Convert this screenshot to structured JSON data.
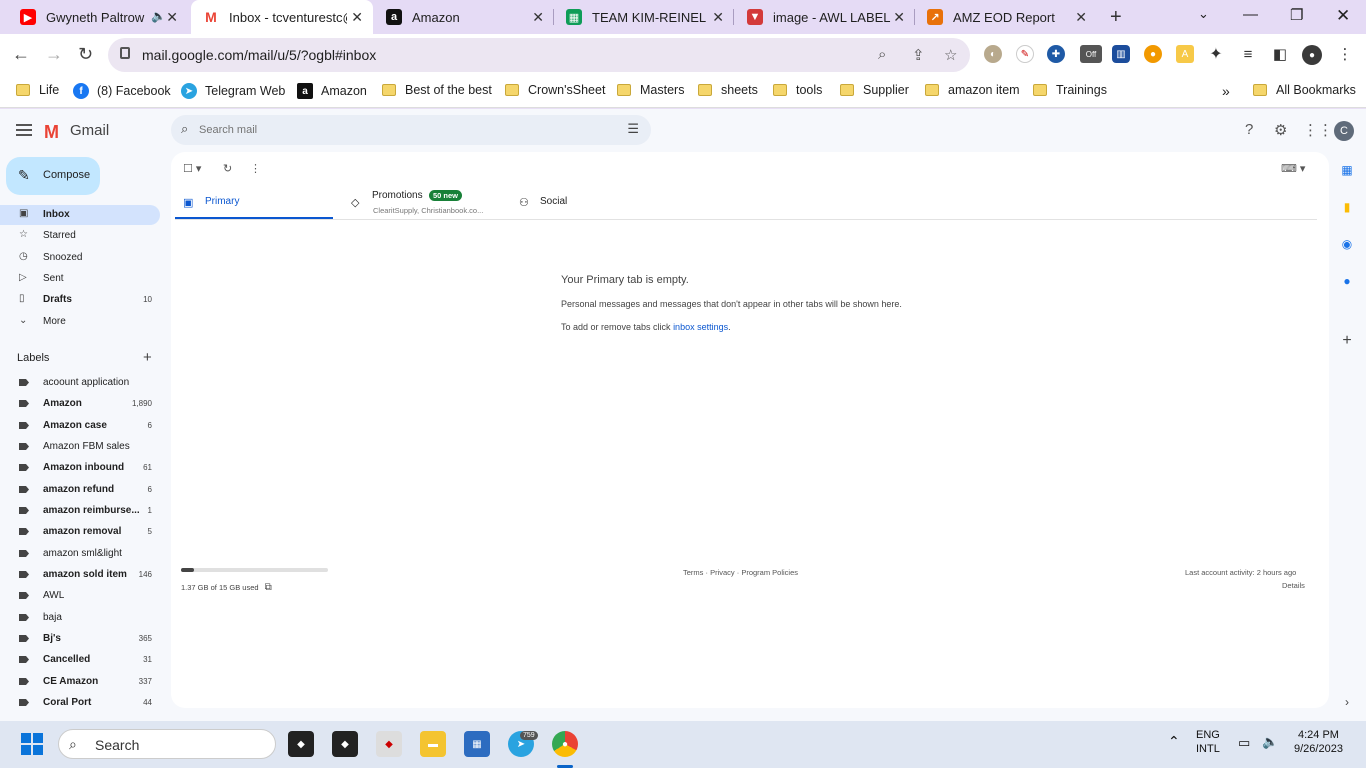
{
  "browser": {
    "tabs": [
      {
        "title": "Gwyneth Paltrow",
        "icon": "youtube-icon",
        "color": "#ff0000",
        "audio": true
      },
      {
        "title": "Inbox - tcventurestc@",
        "icon": "gmail-icon",
        "color": "#ea4335",
        "active": true
      },
      {
        "title": "Amazon",
        "icon": "amazon-icon",
        "color": "#111111"
      },
      {
        "title": "TEAM KIM-REINEL PR",
        "icon": "sheets-icon",
        "color": "#0f9d58"
      },
      {
        "title": "image - AWL LABEL",
        "icon": "vivaldi-icon",
        "color": "#d33a3a"
      },
      {
        "title": "AMZ EOD Report",
        "icon": "report-icon",
        "color": "#e8710a"
      }
    ],
    "url": "mail.google.com/mail/u/5/?ogbl#inbox",
    "ext_badge": "Off",
    "bookmarks": [
      {
        "label": "Life",
        "type": "folder"
      },
      {
        "label": "(8) Facebook",
        "type": "facebook"
      },
      {
        "label": "Telegram Web",
        "type": "telegram"
      },
      {
        "label": "Amazon",
        "type": "amazon"
      },
      {
        "label": "Best of the best",
        "type": "folder"
      },
      {
        "label": "Crown'sSheet",
        "type": "folder"
      },
      {
        "label": "Masters",
        "type": "folder"
      },
      {
        "label": "sheets",
        "type": "folder"
      },
      {
        "label": "tools",
        "type": "folder"
      },
      {
        "label": "Supplier",
        "type": "folder"
      },
      {
        "label": "amazon item",
        "type": "folder"
      },
      {
        "label": "Trainings",
        "type": "folder"
      }
    ],
    "all_bookmarks": "All Bookmarks"
  },
  "gmail": {
    "app_name": "Gmail",
    "search_placeholder": "Search mail",
    "avatar_letter": "C",
    "compose": "Compose",
    "nav": [
      {
        "label": "Inbox",
        "icon": "inbox-icon",
        "count": "",
        "active": true,
        "bold": true
      },
      {
        "label": "Starred",
        "icon": "star-icon",
        "count": ""
      },
      {
        "label": "Snoozed",
        "icon": "clock-icon",
        "count": ""
      },
      {
        "label": "Sent",
        "icon": "send-icon",
        "count": ""
      },
      {
        "label": "Drafts",
        "icon": "draft-icon",
        "count": "10",
        "bold": true
      },
      {
        "label": "More",
        "icon": "chevron-down-icon",
        "count": ""
      }
    ],
    "labels_header": "Labels",
    "labels": [
      {
        "label": "acoount application",
        "count": "",
        "bold": false
      },
      {
        "label": "Amazon",
        "count": "1,890",
        "bold": true
      },
      {
        "label": "Amazon case",
        "count": "6",
        "bold": true
      },
      {
        "label": "Amazon FBM sales",
        "count": "",
        "bold": false
      },
      {
        "label": "Amazon inbound",
        "count": "61",
        "bold": true
      },
      {
        "label": "amazon refund",
        "count": "6",
        "bold": true
      },
      {
        "label": "amazon reimburse...",
        "count": "1",
        "bold": true
      },
      {
        "label": "amazon removal",
        "count": "5",
        "bold": true
      },
      {
        "label": "amazon sml&light",
        "count": "",
        "bold": false
      },
      {
        "label": "amazon sold item",
        "count": "146",
        "bold": true
      },
      {
        "label": "AWL",
        "count": "",
        "bold": false
      },
      {
        "label": "baja",
        "count": "",
        "bold": false
      },
      {
        "label": "Bj's",
        "count": "365",
        "bold": true
      },
      {
        "label": "Cancelled",
        "count": "31",
        "bold": true
      },
      {
        "label": "CE Amazon",
        "count": "337",
        "bold": true
      },
      {
        "label": "Coral Port",
        "count": "44",
        "bold": true
      }
    ],
    "category_tabs": {
      "primary": "Primary",
      "promotions": "Promotions",
      "promotions_badge": "50 new",
      "promotions_senders": "ClearitSupply, Christianbook.co...",
      "social": "Social"
    },
    "empty": {
      "title": "Your Primary tab is empty.",
      "line1": "Personal messages and messages that don't appear in other tabs will be shown here.",
      "line2_prefix": "To add or remove tabs click ",
      "line2_link": "inbox settings",
      "line2_suffix": "."
    },
    "storage": {
      "text": "1.37 GB of 15 GB used",
      "fraction": 0.091
    },
    "footer": {
      "links": "Terms · Privacy · Program Policies",
      "activity": "Last account activity: 2 hours ago",
      "details": "Details"
    }
  },
  "taskbar": {
    "search": "Search",
    "telegram_badge": "759",
    "lang1": "ENG",
    "lang2": "INTL",
    "time": "4:24 PM",
    "date": "9/26/2023"
  }
}
